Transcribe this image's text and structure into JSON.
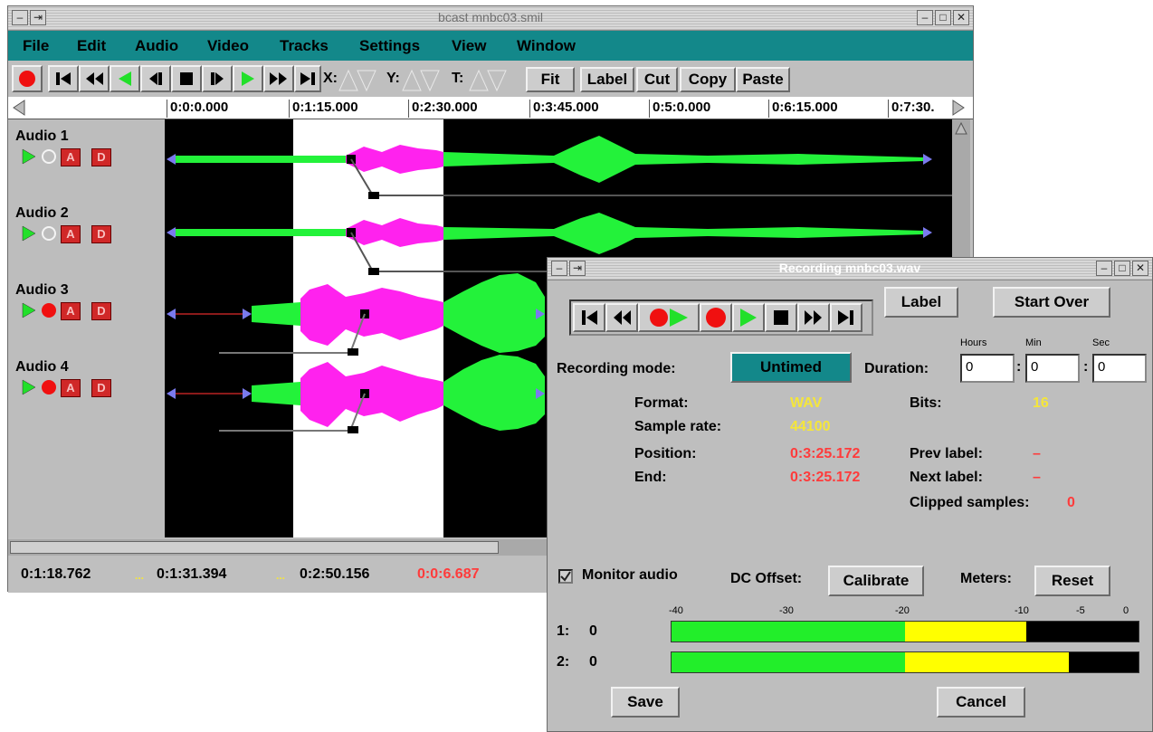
{
  "main_window": {
    "title": "bcast mnbc03.smil",
    "menu": [
      "File",
      "Edit",
      "Audio",
      "Video",
      "Tracks",
      "Settings",
      "View",
      "Window"
    ],
    "toolbar": {
      "x_label": "X:",
      "y_label": "Y:",
      "t_label": "T:",
      "fit_label": "Fit",
      "label_label": "Label",
      "cut_label": "Cut",
      "copy_label": "Copy",
      "paste_label": "Paste"
    },
    "ruler_ticks": [
      "0:0:0.000",
      "0:1:15.000",
      "0:2:30.000",
      "0:3:45.000",
      "0:5:0.000",
      "0:6:15.000",
      "0:7:30."
    ],
    "tracks": [
      {
        "name": "Audio 1",
        "record_armed": false
      },
      {
        "name": "Audio 2",
        "record_armed": false
      },
      {
        "name": "Audio 3",
        "record_armed": true
      },
      {
        "name": "Audio 4",
        "record_armed": true
      }
    ],
    "track_buttons": {
      "a": "A",
      "d": "D"
    },
    "status": {
      "cursor_time": "0:1:18.762",
      "sel_start": "0:1:31.394",
      "sel_end": "0:2:50.156",
      "sel_length": "0:0:6.687",
      "sep": "..."
    }
  },
  "recording_dialog": {
    "title": "Recording mnbc03.wav",
    "label_button": "Label",
    "start_over_button": "Start Over",
    "recording_mode_label": "Recording mode:",
    "mode_value": "Untimed",
    "duration_label": "Duration:",
    "duration_headers": {
      "hours": "Hours",
      "min": "Min",
      "sec": "Sec"
    },
    "duration": {
      "hours": "0",
      "min": "0",
      "sec": "0"
    },
    "colon": ":",
    "format_label": "Format:",
    "format_value": "WAV",
    "bits_label": "Bits:",
    "bits_value": "16",
    "sample_rate_label": "Sample rate:",
    "sample_rate_value": "44100",
    "position_label": "Position:",
    "position_value": "0:3:25.172",
    "end_label": "End:",
    "end_value": "0:3:25.172",
    "prev_label_label": "Prev label:",
    "prev_label_value": "–",
    "next_label_label": "Next label:",
    "next_label_value": "–",
    "clipped_label": "Clipped samples:",
    "clipped_value": "0",
    "monitor_label": "Monitor audio",
    "monitor_checked": true,
    "dc_offset_label": "DC Offset:",
    "calibrate_button": "Calibrate",
    "meters_label": "Meters:",
    "reset_button": "Reset",
    "meter_scale": [
      "-40",
      "-30",
      "-20",
      "-10",
      "-5",
      "0"
    ],
    "meters": [
      {
        "channel": "1:",
        "peak": "0",
        "green_fraction": 0.5,
        "yellow_fraction": 0.76
      },
      {
        "channel": "2:",
        "peak": "0",
        "green_fraction": 0.5,
        "yellow_fraction": 0.85
      }
    ],
    "save_button": "Save",
    "cancel_button": "Cancel"
  },
  "colors": {
    "menubar": "#13888a",
    "wave_green": "#23f23a",
    "wave_magenta": "#ff22ee",
    "accent_yellow": "#f5e63a",
    "accent_red": "#ff3b3b"
  }
}
